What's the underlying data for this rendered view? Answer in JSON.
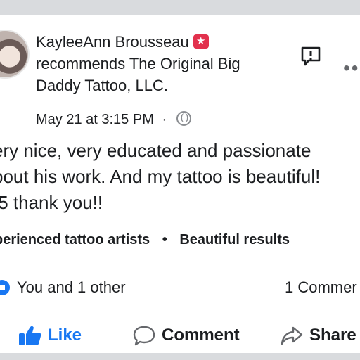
{
  "post": {
    "author": "KayleeAnn Brousseau",
    "action_line_1": "recommends The Original Big",
    "action_line_2": "Daddy Tattoo, LLC.",
    "timestamp": "May 21 at 3:15 PM",
    "separator": "·",
    "body_lines": [
      "ery nice, very educated and passionate",
      "bout his work. And my tattoo is beautiful!",
      "/5 thank you!!"
    ],
    "tags": [
      "periencedtattooartists",
      "Beautiful results"
    ],
    "tags_display": [
      "perienced tattoo artists",
      "Beautiful results"
    ],
    "tag_separator": "•",
    "reactions_text": "You and 1 other",
    "comments_text": "1 Commer"
  },
  "actions": {
    "like_label": "Like",
    "comment_label": "Comment",
    "share_label": "Share"
  },
  "icons": {
    "badge": "star-badge-icon",
    "globe": "globe-icon",
    "report": "report-icon",
    "more": "more-icon",
    "like": "thumbs-up-icon",
    "comment": "comment-icon",
    "share": "share-icon"
  },
  "colors": {
    "accent": "#1877f2",
    "badge": "#e2314d",
    "text": "#1c1e21",
    "muted": "#65676b"
  }
}
